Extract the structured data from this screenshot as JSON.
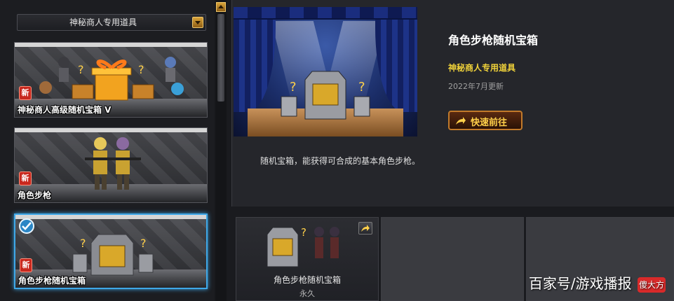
{
  "sidebar": {
    "category_dropdown": {
      "selected": "神秘商人专用道具"
    },
    "new_badge_label": "新",
    "items": [
      {
        "name": "神秘商人高级随机宝箱 V",
        "is_new": true,
        "selected": false
      },
      {
        "name": "角色步枪",
        "is_new": true,
        "selected": false
      },
      {
        "name": "角色步枪随机宝箱",
        "is_new": true,
        "selected": true
      }
    ]
  },
  "detail": {
    "title": "角色步枪随机宝箱",
    "category": "神秘商人专用道具",
    "updated": "2022年7月更新",
    "goto_button_label": "快速前往",
    "description": "随机宝箱，能获得可合成的基本角色步枪。"
  },
  "rewards": [
    {
      "name": "角色步枪随机宝箱",
      "duration": "永久"
    }
  ],
  "watermark": {
    "text": "百家号/游戏播报",
    "icon_text": "傻大方"
  },
  "colors": {
    "accent_gold": "#f0d23a",
    "selection_blue": "#3fa8e8",
    "new_badge_red": "#c8281e"
  }
}
